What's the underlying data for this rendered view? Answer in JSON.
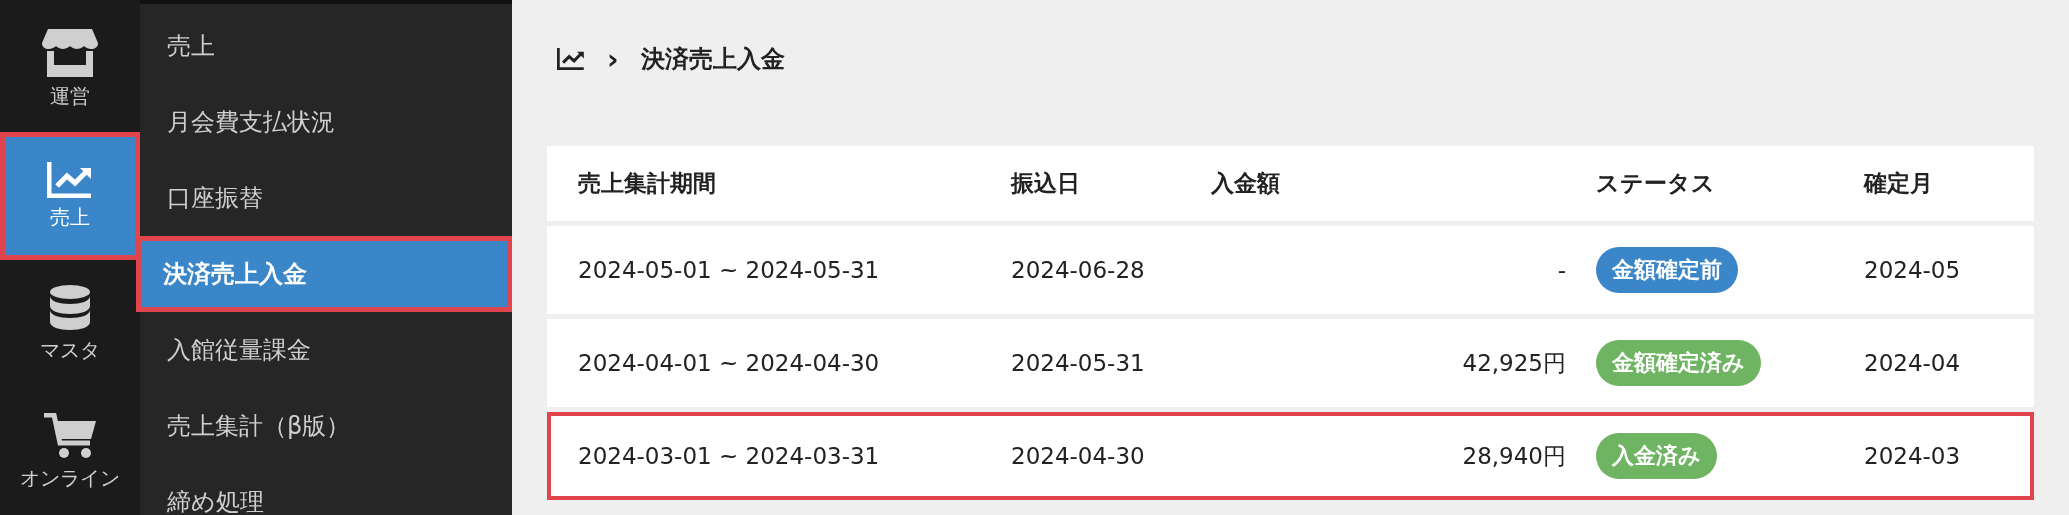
{
  "rail": [
    {
      "kind": "store",
      "label": "運営",
      "selected": false,
      "highlighted": false
    },
    {
      "kind": "chart",
      "label": "売上",
      "selected": true,
      "highlighted": true
    },
    {
      "kind": "database",
      "label": "マスタ",
      "selected": false,
      "highlighted": false
    },
    {
      "kind": "cart",
      "label": "オンライン",
      "selected": false,
      "highlighted": false
    }
  ],
  "submenu": [
    {
      "label": "売上",
      "selected": false,
      "highlighted": false
    },
    {
      "label": "月会費支払状況",
      "selected": false,
      "highlighted": false
    },
    {
      "label": "口座振替",
      "selected": false,
      "highlighted": false
    },
    {
      "label": "決済売上入金",
      "selected": true,
      "highlighted": true
    },
    {
      "label": "入館従量課金",
      "selected": false,
      "highlighted": false
    },
    {
      "label": "売上集計（β版）",
      "selected": false,
      "highlighted": false
    },
    {
      "label": "締め処理",
      "selected": false,
      "highlighted": false
    }
  ],
  "breadcrumb": {
    "separator": "›",
    "current": "決済売上入金"
  },
  "table": {
    "columns": [
      "売上集計期間",
      "振込日",
      "入金額",
      "ステータス",
      "確定月"
    ],
    "rows": [
      {
        "period": "2024-05-01 ~ 2024-05-31",
        "transfer_date": "2024-06-28",
        "amount": "-",
        "status": {
          "label": "金額確定前",
          "color": "#3b86c8"
        },
        "month": "2024-05",
        "highlighted": false
      },
      {
        "period": "2024-04-01 ~ 2024-04-30",
        "transfer_date": "2024-05-31",
        "amount": "42,925円",
        "status": {
          "label": "金額確定済み",
          "color": "#6fb462"
        },
        "month": "2024-04",
        "highlighted": false
      },
      {
        "period": "2024-03-01 ~ 2024-03-31",
        "transfer_date": "2024-04-30",
        "amount": "28,940円",
        "status": {
          "label": "入金済み",
          "color": "#6fb462"
        },
        "month": "2024-03",
        "highlighted": true
      }
    ]
  }
}
